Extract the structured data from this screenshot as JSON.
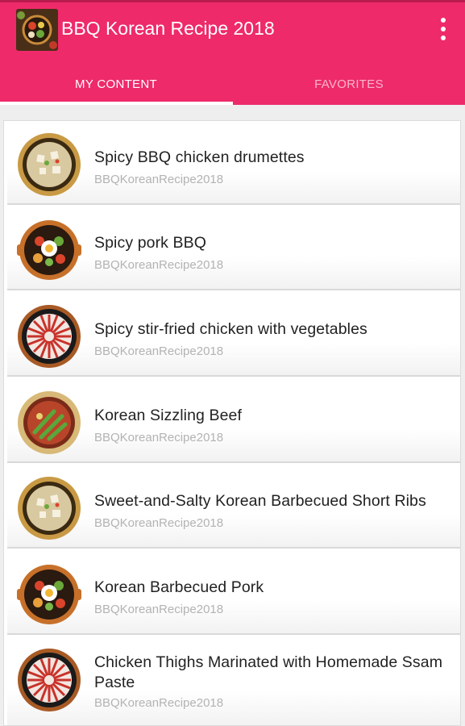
{
  "app": {
    "title": "BBQ Korean Recipe 2018",
    "icon": "app-food-icon",
    "accent_color": "#ee2a6a"
  },
  "menu": {
    "icon": "more-vert-icon"
  },
  "tabs": [
    {
      "label": "MY CONTENT",
      "selected": true
    },
    {
      "label": "FAVORITES",
      "selected": false
    }
  ],
  "items": [
    {
      "title": "Spicy BBQ chicken drumettes",
      "subtitle": "BBQKoreanRecipe2018",
      "thumb": "soup-bowl-icon"
    },
    {
      "title": "Spicy pork BBQ",
      "subtitle": "BBQKoreanRecipe2018",
      "thumb": "bibimbap-icon"
    },
    {
      "title": "Spicy stir-fried chicken with vegetables",
      "subtitle": "BBQKoreanRecipe2018",
      "thumb": "hotpot-icon"
    },
    {
      "title": "Korean Sizzling Beef",
      "subtitle": "BBQKoreanRecipe2018",
      "thumb": "stew-bowl-icon"
    },
    {
      "title": "Sweet-and-Salty Korean Barbecued Short Ribs",
      "subtitle": "BBQKoreanRecipe2018",
      "thumb": "soup-bowl-icon"
    },
    {
      "title": "Korean Barbecued Pork",
      "subtitle": "BBQKoreanRecipe2018",
      "thumb": "bibimbap-icon"
    },
    {
      "title": "Chicken Thighs Marinated with Homemade Ssam Paste",
      "subtitle": "BBQKoreanRecipe2018",
      "thumb": "hotpot-icon"
    }
  ]
}
